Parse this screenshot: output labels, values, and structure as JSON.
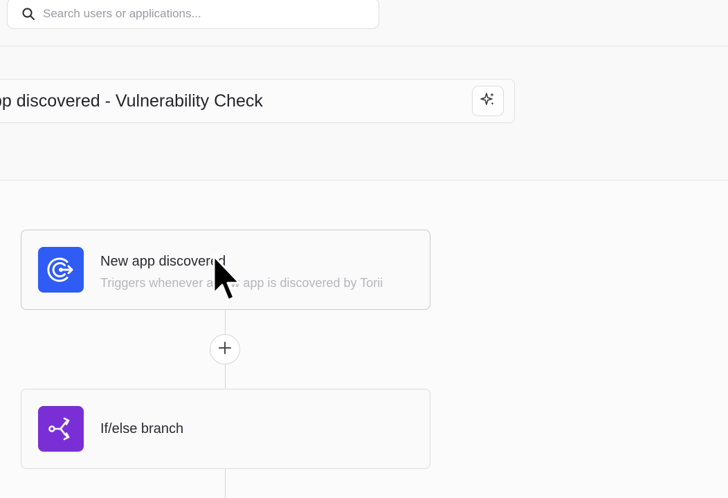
{
  "search": {
    "placeholder": "Search users or applications..."
  },
  "workflow": {
    "title": "pp discovered - Vulnerability Check",
    "ai_button_icon": "sparkles-icon"
  },
  "nodes": [
    {
      "title": "New app discovered",
      "description": "Triggers whenever a new app is discovered by Torii",
      "icon": "app-discovery-icon",
      "icon_color": "#2f5cf4"
    },
    {
      "title": "If/else branch",
      "description": "",
      "icon": "branch-icon",
      "icon_color": "#7a2fd6"
    }
  ],
  "add_step_icon": "plus-icon",
  "colors": {
    "background": "#f9f9fa",
    "border": "#dedee2",
    "trigger_blue": "#2f5cf4",
    "branch_purple": "#7a2fd6"
  }
}
